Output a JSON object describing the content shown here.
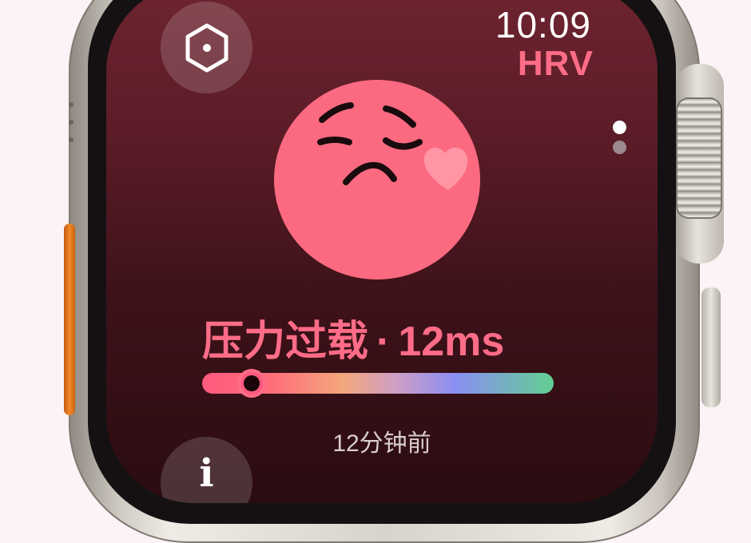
{
  "status_bar": {
    "time": "10:09",
    "app_name": "HRV"
  },
  "buttons": {
    "menu_icon": "hexagon-icon",
    "info_label": "i"
  },
  "pager": {
    "pages": 2,
    "current": 1
  },
  "metric": {
    "state": "压力过载",
    "separator": "·",
    "value": "12ms",
    "gauge_level": 0.14
  },
  "timestamp": "12分钟前",
  "colors": {
    "accent": "#ff6c87",
    "face": "#fb6a81",
    "background_top": "#6e2430",
    "background_bottom": "#2a0c11"
  }
}
